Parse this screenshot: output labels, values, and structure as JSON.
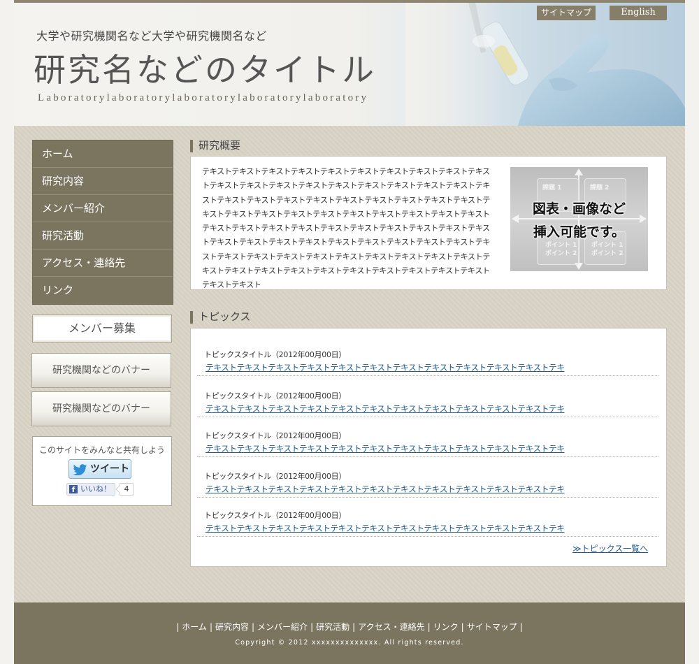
{
  "header": {
    "subtitle": "大学や研究機関名など大学や研究機関名など",
    "title": "研究名などのタイトル",
    "tagline": "Laboratorylaboratorylaboratorylaboratorylaboratory",
    "links": {
      "sitemap": "サイトマップ",
      "english": "English"
    }
  },
  "nav": {
    "items": [
      "ホーム",
      "研究内容",
      "メンバー紹介",
      "研究活動",
      "アクセス・連絡先",
      "リンク"
    ]
  },
  "sidebar": {
    "recruit": "メンバー募集",
    "banners": [
      "研究機関などのバナー",
      "研究機関などのバナー"
    ],
    "share": {
      "title": "このサイトをみんなと共有しよう",
      "tweet": "ツイート",
      "like": "いいね！",
      "like_count": "4"
    }
  },
  "overview": {
    "heading": "研究概要",
    "text": "テキストテキストテキストテキストテキストテキストテキストテキストテキストテキストテキストテキストテキストテキストテキストテキストテキストテキストテキストテキストテキストテキストテキストテキストテキストテキストテキストテキストテキストテキストテキストテキストテキストテキストテキストテキストテキストテキストテキストテキストテキストテキストテキストテキストテキストテキストテキストテキストテキストテキストテキストテキストテキストテキストテキストテキストテキストテキストテキストテキストテキストテキストテキストテキストテキストテキストテキストテキストテキストテキストテキストテキストテキストテキストテキストテキストテキストテキストテキストテキスト",
    "figure": {
      "caption_line1": "図表・画像など",
      "caption_line2": "挿入可能です。",
      "box1": "課題 1",
      "box2": "課題 2",
      "point1": "ポイント 1",
      "point2": "ポイント 2"
    }
  },
  "topics": {
    "heading": "トピックス",
    "items": [
      {
        "title": "トピックスタイトル（2012年00月00日）",
        "text": "テキストテキストテキストテキストテキストテキストテキストテキストテキストテキストテキストテキ"
      },
      {
        "title": "トピックスタイトル（2012年00月00日）",
        "text": "テキストテキストテキストテキストテキストテキストテキストテキストテキストテキストテキストテキ"
      },
      {
        "title": "トピックスタイトル（2012年00月00日）",
        "text": "テキストテキストテキストテキストテキストテキストテキストテキストテキストテキストテキストテキ"
      },
      {
        "title": "トピックスタイトル（2012年00月00日）",
        "text": "テキストテキストテキストテキストテキストテキストテキストテキストテキストテキストテキストテキ"
      },
      {
        "title": "トピックスタイトル（2012年00月00日）",
        "text": "テキストテキストテキストテキストテキストテキストテキストテキストテキストテキストテキストテキ"
      }
    ],
    "more": "≫トピックス一覧へ"
  },
  "footer": {
    "separator": "|",
    "links": [
      "ホーム",
      "研究内容",
      "メンバー紹介",
      "研究活動",
      "アクセス・連絡先",
      "リンク",
      "サイトマップ"
    ],
    "copyright": "Copyright © 2012 xxxxxxxxxxxxxx. All rights reserved."
  },
  "colors": {
    "nav_bg": "#7b7560",
    "footer_bg": "#7b7560",
    "page_bg": "#d6d0c2",
    "link": "#1f5a8a"
  }
}
